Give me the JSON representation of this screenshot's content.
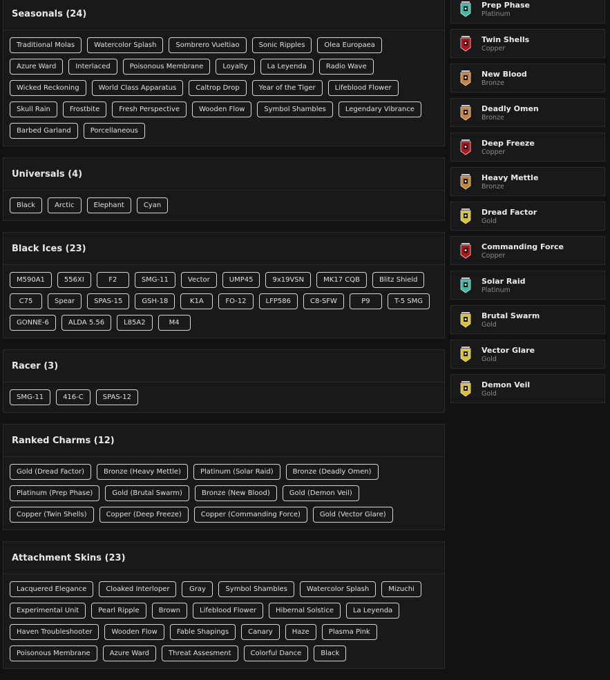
{
  "sections": [
    {
      "title": "Seasonals (24)",
      "items": [
        "Traditional Molas",
        "Watercolor Splash",
        "Sombrero Vueltiao",
        "Sonic Ripples",
        "Olea Europaea",
        "Azure Ward",
        "Interlaced",
        "Poisonous Membrane",
        "Loyalty",
        "La Leyenda",
        "Radio Wave",
        "Wicked Reckoning",
        "World Class Apparatus",
        "Caltrop Drop",
        "Year of the Tiger",
        "Lifeblood Flower",
        "Skull Rain",
        "Frostbite",
        "Fresh Perspective",
        "Wooden Flow",
        "Symbol Shambles",
        "Legendary Vibrance",
        "Barbed Garland",
        "Porcellaneous"
      ]
    },
    {
      "title": "Universals (4)",
      "items": [
        "Black",
        "Arctic",
        "Elephant",
        "Cyan"
      ]
    },
    {
      "title": "Black Ices (23)",
      "items": [
        "M590A1",
        "556XI",
        "F2",
        "SMG-11",
        "Vector",
        "UMP45",
        "9x19VSN",
        "MK17 CQB",
        "Blitz Shield",
        "C75",
        "Spear",
        "SPAS-15",
        "GSH-18",
        "K1A",
        "FO-12",
        "LFP586",
        "C8-SFW",
        "P9",
        "T-5 SMG",
        "GONNE-6",
        "ALDA 5.56",
        "L85A2",
        "M4"
      ]
    },
    {
      "title": "Racer (3)",
      "items": [
        "SMG-11",
        "416-C",
        "SPAS-12"
      ]
    },
    {
      "title": "Ranked Charms (12)",
      "items": [
        "Gold (Dread Factor)",
        "Bronze (Heavy Mettle)",
        "Platinum (Solar Raid)",
        "Bronze (Deadly Omen)",
        "Platinum (Prep Phase)",
        "Gold (Brutal Swarm)",
        "Bronze (New Blood)",
        "Gold (Demon Veil)",
        "Copper (Twin Shells)",
        "Copper (Deep Freeze)",
        "Copper (Commanding Force)",
        "Gold (Vector Glare)"
      ]
    },
    {
      "title": "Attachment Skins (23)",
      "items": [
        "Lacquered Elegance",
        "Cloaked Interloper",
        "Gray",
        "Symbol Shambles",
        "Watercolor Splash",
        "Mizuchi",
        "Experimental Unit",
        "Pearl Ripple",
        "Brown",
        "Lifeblood Flower",
        "Hibernal Solstice",
        "La Leyenda",
        "Haven Troubleshooter",
        "Wooden Flow",
        "Fable Shapings",
        "Canary",
        "Haze",
        "Plasma Pink",
        "Poisonous Membrane",
        "Azure Ward",
        "Threat Assesment",
        "Colorful Dance",
        "Black"
      ]
    }
  ],
  "charms": [
    {
      "name": "Prep Phase",
      "tier": "Platinum"
    },
    {
      "name": "Twin Shells",
      "tier": "Copper"
    },
    {
      "name": "New Blood",
      "tier": "Bronze"
    },
    {
      "name": "Deadly Omen",
      "tier": "Bronze"
    },
    {
      "name": "Deep Freeze",
      "tier": "Copper"
    },
    {
      "name": "Heavy Mettle",
      "tier": "Bronze"
    },
    {
      "name": "Dread Factor",
      "tier": "Gold"
    },
    {
      "name": "Commanding Force",
      "tier": "Copper"
    },
    {
      "name": "Solar Raid",
      "tier": "Platinum"
    },
    {
      "name": "Brutal Swarm",
      "tier": "Gold"
    },
    {
      "name": "Vector Glare",
      "tier": "Gold"
    },
    {
      "name": "Demon Veil",
      "tier": "Gold"
    }
  ],
  "tier_colors": {
    "Platinum": "#3fb8a8",
    "Copper": "#b3141c",
    "Bronze": "#c4823a",
    "Gold": "#d8c23a"
  }
}
